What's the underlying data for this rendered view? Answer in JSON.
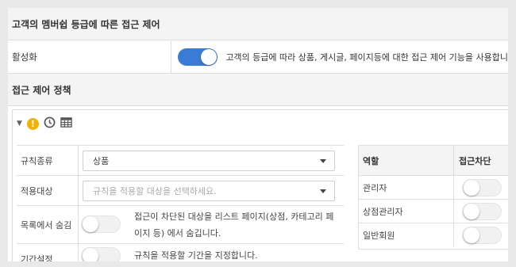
{
  "section1": {
    "title": "고객의 멤버쉽 등급에 따른 접근 제어"
  },
  "activate": {
    "label": "활성화",
    "enabled": true,
    "description": "고객의 등급에 따라 상품, 게시글, 페이지등에 대한 접근 제어 기능을 사용합니"
  },
  "section2": {
    "title": "접근 제어 정책"
  },
  "toolbar": {
    "icons": [
      "chevron-down-icon",
      "warning-icon",
      "clock-icon",
      "table-icon"
    ],
    "warning_glyph": "!"
  },
  "form": {
    "rule_type": {
      "label": "규칙종류",
      "value": "상품"
    },
    "target": {
      "label": "적용대상",
      "placeholder": "규칙을 적용할 대상을 선택하세요."
    },
    "hide_in_list": {
      "label": "목록에서 숨김",
      "enabled": false,
      "description": "접근이 차단된 대상을 리스트 페이지(상점, 카테고리 페이지 등) 에서 숨깁니다."
    },
    "period": {
      "label": "기간설정",
      "enabled": false,
      "description": "규칙을 적용할 기간을 지정합니다."
    }
  },
  "roles": {
    "headers": {
      "role": "역할",
      "block": "접근차단"
    },
    "rows": [
      {
        "name": "관리자",
        "blocked": false
      },
      {
        "name": "상점관리자",
        "blocked": false
      },
      {
        "name": "일반회원",
        "blocked": false
      }
    ]
  },
  "colors": {
    "accent": "#3a7bd5",
    "warning": "#f0b400"
  }
}
